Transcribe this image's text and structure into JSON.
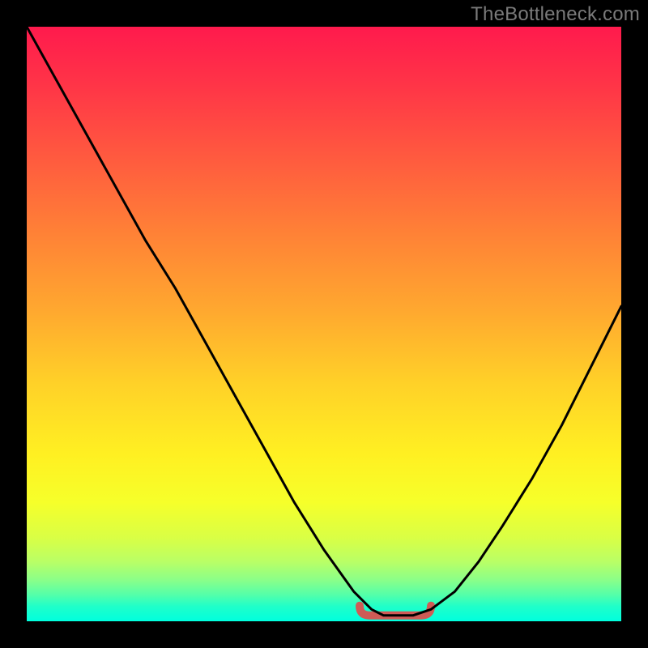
{
  "watermark": "TheBottleneck.com",
  "colors": {
    "background": "#000000",
    "curve": "#000000",
    "marker": "#cf5b56",
    "gradient_top": "#ff1a4d",
    "gradient_bottom": "#00ffde"
  },
  "chart_data": {
    "type": "line",
    "title": "",
    "xlabel": "",
    "ylabel": "",
    "xlim": [
      0,
      100
    ],
    "ylim": [
      0,
      100
    ],
    "grid": false,
    "legend": false,
    "series": [
      {
        "name": "bottleneck-curve",
        "x": [
          0,
          5,
          10,
          15,
          20,
          25,
          30,
          35,
          40,
          45,
          50,
          55,
          58,
          60,
          62,
          65,
          68,
          72,
          76,
          80,
          85,
          90,
          95,
          100
        ],
        "values": [
          100,
          91,
          82,
          73,
          64,
          56,
          47,
          38,
          29,
          20,
          12,
          5,
          2,
          1,
          1,
          1,
          2,
          5,
          10,
          16,
          24,
          33,
          43,
          53
        ]
      }
    ],
    "annotations": [
      {
        "name": "optimal-range-marker",
        "x_start": 56,
        "x_end": 68,
        "y": 1
      }
    ],
    "background_gradient": {
      "axis": "y",
      "stops": [
        {
          "y": 100,
          "color": "#ff1a4d"
        },
        {
          "y": 72,
          "color": "#fff022"
        },
        {
          "y": 0,
          "color": "#00ffde"
        }
      ],
      "meaning": "red = high bottleneck, green = low bottleneck"
    }
  }
}
